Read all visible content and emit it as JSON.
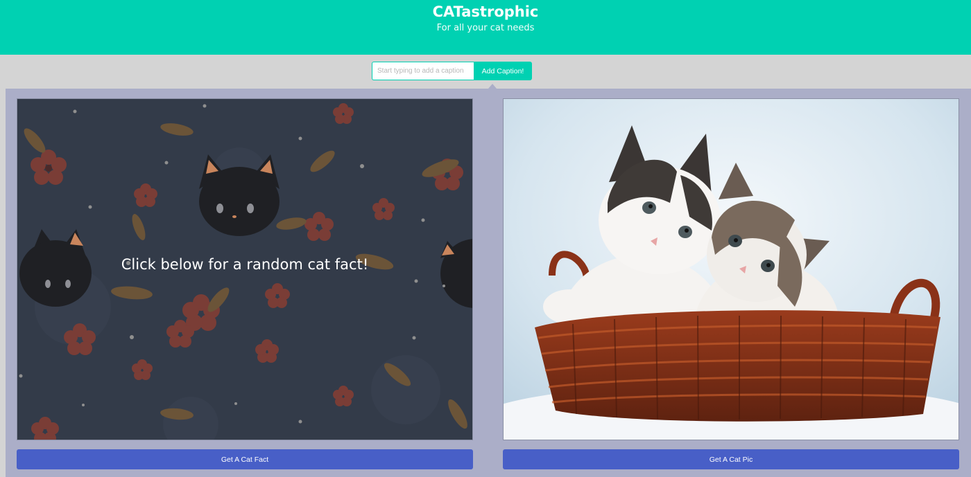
{
  "header": {
    "title": "CATastrophic",
    "subtitle": "For all your cat needs"
  },
  "caption": {
    "placeholder": "Start typing to add a caption",
    "button_label": "Add Caption!"
  },
  "fact_card": {
    "prompt": "Click below for a random cat fact!",
    "button_label": "Get A Cat Fact"
  },
  "pic_card": {
    "button_label": "Get A Cat Pic"
  },
  "colors": {
    "brand": "#00d1b2",
    "button": "#485fc7",
    "panel": "#abaec8",
    "background": "#d4d4d4"
  }
}
